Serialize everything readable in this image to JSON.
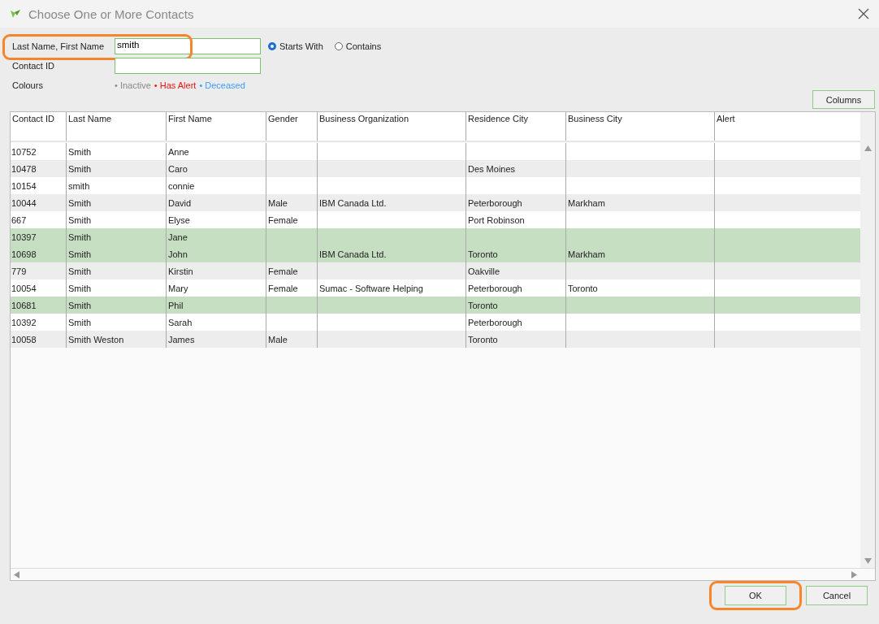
{
  "window": {
    "title": "Choose One or More Contacts"
  },
  "search": {
    "name_label": "Last Name, First Name",
    "name_value": "smith",
    "name_highlighted": true,
    "id_label": "Contact ID",
    "match_options": [
      {
        "label": "Starts With",
        "selected": true
      },
      {
        "label": "Contains",
        "selected": false
      }
    ]
  },
  "colours": {
    "label": "Colours",
    "items": [
      {
        "label": "• Inactive",
        "color": "#8a8a8a"
      },
      {
        "label": "• Has Alert",
        "color": "#ee1111"
      },
      {
        "label": "• Deceased",
        "color": "#3d9bff"
      }
    ]
  },
  "columns_button": "Columns",
  "table": {
    "columns": [
      "Contact ID",
      "Last Name",
      "First Name",
      "Gender",
      "Business Organization",
      "Residence City",
      "Business City",
      "Alert"
    ],
    "rows": [
      {
        "cells": [
          "10752",
          "Smith",
          "Anne",
          "",
          "",
          "",
          "",
          ""
        ],
        "selected": false
      },
      {
        "cells": [
          "10478",
          "Smith",
          "Caro",
          "",
          "",
          "Des Moines",
          "",
          ""
        ],
        "selected": false
      },
      {
        "cells": [
          "10154",
          "smith",
          "connie",
          "",
          "",
          "",
          "",
          ""
        ],
        "selected": false
      },
      {
        "cells": [
          "10044",
          "Smith",
          "David",
          "Male",
          "IBM Canada Ltd.",
          "Peterborough",
          "Markham",
          ""
        ],
        "selected": false
      },
      {
        "cells": [
          "667",
          "Smith",
          "Elyse",
          "Female",
          "",
          "Port Robinson",
          "",
          ""
        ],
        "selected": false
      },
      {
        "cells": [
          "10397",
          "Smith",
          "Jane",
          "",
          "",
          "",
          "",
          ""
        ],
        "selected": true
      },
      {
        "cells": [
          "10698",
          "Smith",
          "John",
          "",
          "IBM Canada Ltd.",
          "Toronto",
          "Markham",
          ""
        ],
        "selected": true
      },
      {
        "cells": [
          "779",
          "Smith",
          "Kirstin",
          "Female",
          "",
          "Oakville",
          "",
          ""
        ],
        "selected": false
      },
      {
        "cells": [
          "10054",
          "Smith",
          "Mary",
          "Female",
          "Sumac - Software Helping",
          "Peterborough",
          "Toronto",
          ""
        ],
        "selected": false
      },
      {
        "cells": [
          "10681",
          "Smith",
          "Phil",
          "",
          "",
          "Toronto",
          "",
          ""
        ],
        "selected": true
      },
      {
        "cells": [
          "10392",
          "Smith",
          "Sarah",
          "",
          "",
          "Peterborough",
          "",
          ""
        ],
        "selected": false
      },
      {
        "cells": [
          "10058",
          "Smith Weston",
          "James",
          "Male",
          "",
          "Toronto",
          "",
          ""
        ],
        "selected": false
      }
    ]
  },
  "buttons": [
    {
      "label": "OK",
      "highlighted": true
    },
    {
      "label": "Cancel",
      "highlighted": false
    }
  ]
}
